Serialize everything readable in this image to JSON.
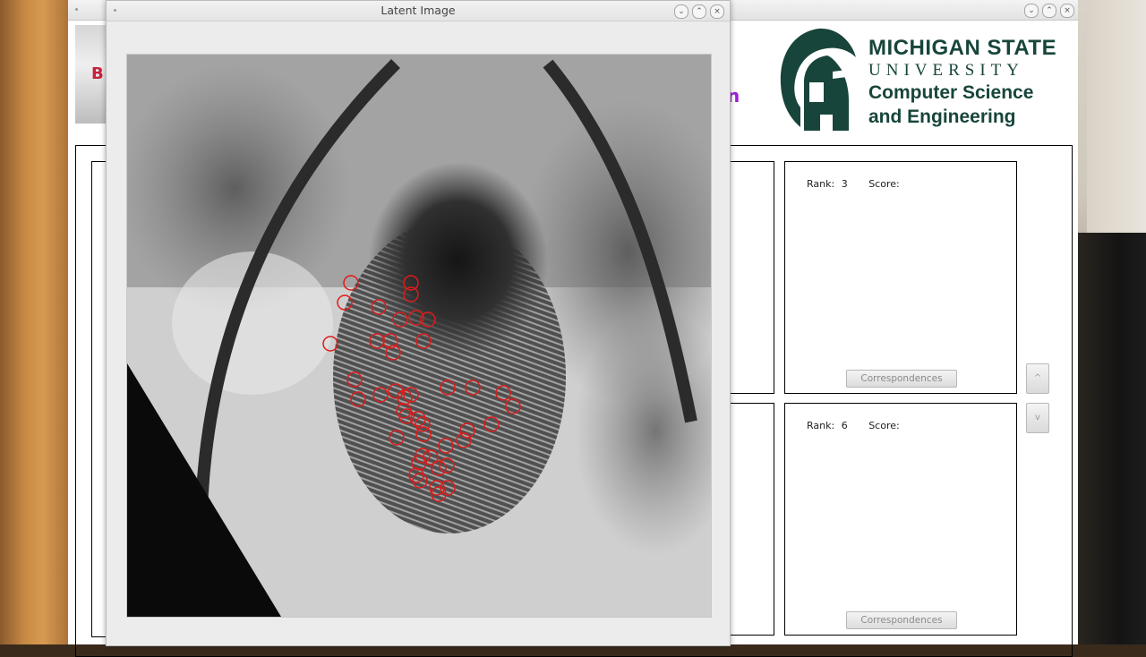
{
  "main_window": {
    "logo_fragment": "B",
    "purple_fragment": "n",
    "msu": {
      "line1": "MICHIGAN STATE",
      "line2": "UNIVERSITY",
      "line3": "Computer Science",
      "line4": "and Engineering",
      "color": "#18453b"
    },
    "results": [
      {
        "rank_label": "Rank:",
        "rank": "3",
        "score_label": "Score:",
        "button": "Correspondences"
      },
      {
        "rank_label": "Rank:",
        "rank": "6",
        "score_label": "Score:",
        "button": "Correspondences"
      }
    ],
    "nav": {
      "up_label": "^",
      "down_label": "v"
    }
  },
  "latent_window": {
    "title": "Latent Image",
    "minutiae_color": "#e01a1a"
  },
  "window_controls": {
    "minimize": "⌄",
    "maximize": "⌃",
    "close": "×"
  }
}
